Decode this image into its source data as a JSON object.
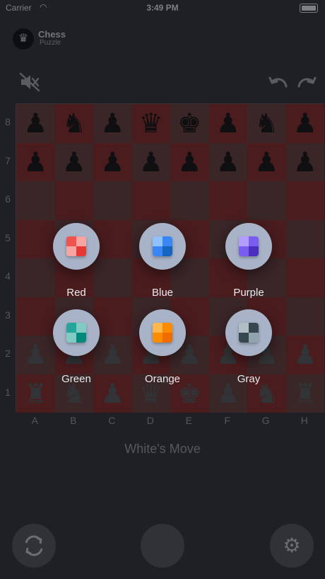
{
  "status_bar": {
    "carrier": "Carrier",
    "time": "3:49 PM"
  },
  "header": {
    "title": "Chess",
    "subtitle": "Puzzle"
  },
  "board": {
    "ranks": [
      "8",
      "7",
      "6",
      "5",
      "4",
      "3",
      "2",
      "1"
    ],
    "files": [
      "A",
      "B",
      "C",
      "D",
      "E",
      "F",
      "G",
      "H"
    ],
    "rows": [
      [
        "bP",
        "bN",
        "bP",
        "bQ",
        "bK",
        "bP",
        "bN",
        "bP"
      ],
      [
        "bP",
        "bP",
        "bP",
        "bP",
        "bP",
        "bP",
        "bP",
        "bP"
      ],
      [
        "",
        "",
        "",
        "",
        "",
        "",
        "",
        ""
      ],
      [
        "",
        "",
        "",
        "",
        "",
        "",
        "",
        ""
      ],
      [
        "",
        "",
        "",
        "",
        "",
        "",
        "",
        ""
      ],
      [
        "",
        "",
        "",
        "",
        "",
        "",
        "",
        ""
      ],
      [
        "wP",
        "wP",
        "wP",
        "wP",
        "wP",
        "wP",
        "wP",
        "wP"
      ],
      [
        "wR",
        "wN",
        "wP",
        "wQ",
        "wK",
        "wP",
        "wN",
        "wR"
      ]
    ],
    "colors": {
      "light": "#3a2527",
      "dark": "#4a1c1e"
    }
  },
  "color_picker": {
    "options": [
      {
        "label": "Red",
        "colors": [
          "#ef5350",
          "#f8a4a2",
          "#f8a4a2",
          "#e53935"
        ]
      },
      {
        "label": "Blue",
        "colors": [
          "#90c2ff",
          "#3b86f5",
          "#3b86f5",
          "#1565c0"
        ]
      },
      {
        "label": "Purple",
        "colors": [
          "#b39dff",
          "#7b5cf0",
          "#7b5cf0",
          "#4a2fbf"
        ]
      },
      {
        "label": "Green",
        "colors": [
          "#26a69a",
          "#80cbc4",
          "#80cbc4",
          "#00897b"
        ]
      },
      {
        "label": "Orange",
        "colors": [
          "#ffb74d",
          "#fb8c00",
          "#fb8c00",
          "#ef6c00"
        ]
      },
      {
        "label": "Gray",
        "colors": [
          "#b0bec5",
          "#37474f",
          "#37474f",
          "#90a4ae"
        ]
      }
    ]
  },
  "turn": {
    "text": "White's Move"
  },
  "icons": {
    "mute": "speaker-mute-icon",
    "undo": "undo-icon",
    "redo": "redo-icon",
    "rotate": "rotate-board-icon",
    "settings": "settings-gear-icon"
  }
}
